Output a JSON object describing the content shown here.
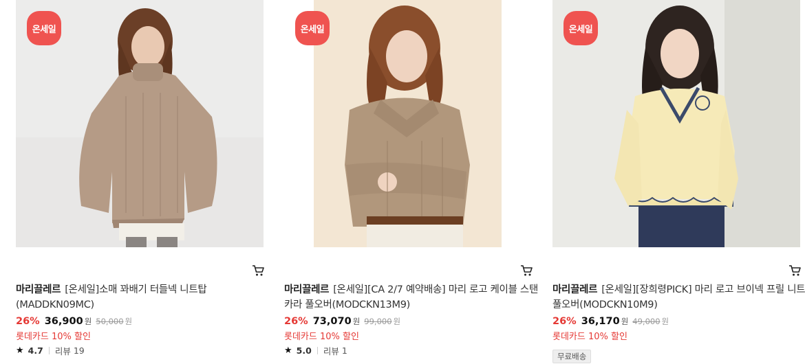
{
  "colors": {
    "sale_badge": "#ef5350",
    "discount": "#e53935",
    "promo": "#e53935"
  },
  "products": [
    {
      "badge": "온세일",
      "brand": "마리끌레르",
      "name": "[온세일]소매 꽈배기 터들넥 니트탑(MADDKN09MC)",
      "discount": "26%",
      "price": "36,900",
      "currency": "원",
      "original_price": "50,000",
      "card_promo": "롯데카드 10% 할인",
      "rating": "4.7",
      "review_label": "리뷰",
      "review_count": "19"
    },
    {
      "badge": "온세일",
      "brand": "마리끌레르",
      "name": "[온세일][CA 2/7 예약배송] 마리 로고 케이블 스탠카라 풀오버(MODCKN13M9)",
      "discount": "26%",
      "price": "73,070",
      "currency": "원",
      "original_price": "99,000",
      "card_promo": "롯데카드 10% 할인",
      "rating": "5.0",
      "review_label": "리뷰",
      "review_count": "1"
    },
    {
      "badge": "온세일",
      "brand": "마리끌레르",
      "name": "[온세일][장희령PICK] 마리 로고 브이넥 프릴 니트 풀오버(MODCKN10M9)",
      "discount": "26%",
      "price": "36,170",
      "currency": "원",
      "original_price": "49,000",
      "card_promo": "롯데카드 10% 할인",
      "tag": "무료배송"
    }
  ]
}
